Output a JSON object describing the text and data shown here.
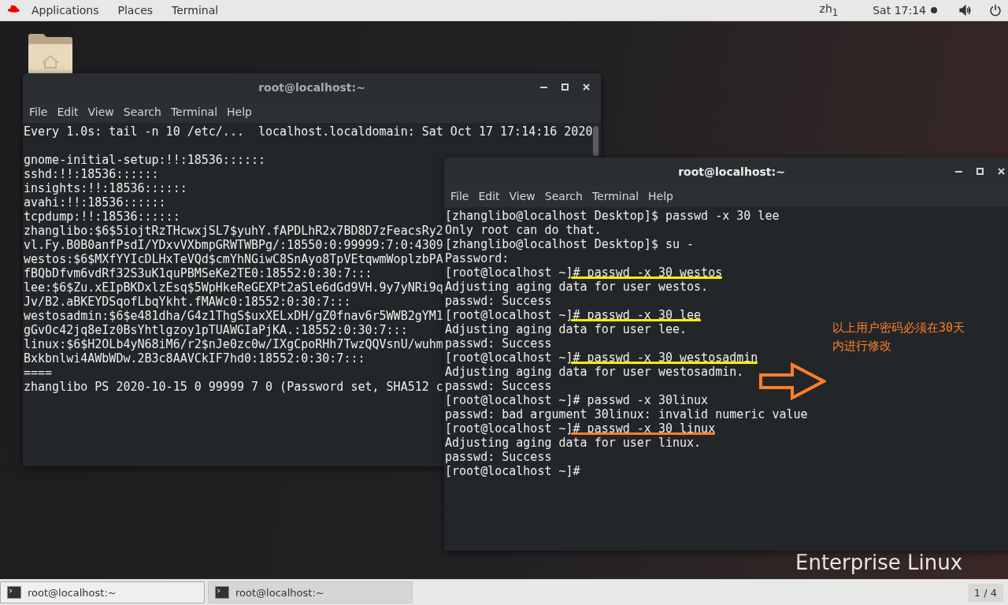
{
  "top_bar": {
    "menus": [
      "Applications",
      "Places",
      "Terminal"
    ],
    "input_method": "zh$_{1}$",
    "clock": "Sat 17:14"
  },
  "desktop": {
    "background_text": "Enterprise Linux"
  },
  "windows": [
    {
      "title": "root@localhost:~",
      "focused": false,
      "menu": [
        "File",
        "Edit",
        "View",
        "Search",
        "Terminal",
        "Help"
      ],
      "header": "Every 1.0s: tail -n 10 /etc/...  localhost.localdomain: Sat Oct 17 17:14:16 2020",
      "lines": [
        {
          "text": "gnome-initial-setup:!!:18536::::::"
        },
        {
          "text": "sshd:!!:18536::::::"
        },
        {
          "text": "insights:!!:18536::::::"
        },
        {
          "text": "avahi:!!:18536::::::"
        },
        {
          "text": "tcpdump:!!:18536::::::"
        },
        {
          "text": "zhanglibo:$6$5iojtRzTHcwxjSL7$yuhY.fAPDLhR2x7BD8D7zFeacsRy2"
        },
        {
          "text": "vl.Fy.B0B0anfPsdI/YDxvVXbmpGRWTWBPg/:18550:0:99999:7:0:4309"
        },
        {
          "text": "westos:$6$MXfYYIcDLHxTeVQd$cmYhNGiwC8SnAyo8TpVEtqwmWoplzbPA"
        },
        {
          "text": "fBQbDfvm6vdRf32S3uK1quPBMSeKe2TE0:18552:0:30:7:::"
        },
        {
          "text": "lee:$6$Zu.xEIpBKDxlzEsq$5WpHkeReGEXPt2aSle6dGd9VH.9y7yNRi9q"
        },
        {
          "text": "Jv/B2.aBKEYDSqofLbqYkht.fMAWc0:18552:0:30:7:::"
        },
        {
          "text": "westosadmin:$6$e481dha/G4z1ThgS$uxXELxDH/gZ0fnav6r5WWB2gYM1"
        },
        {
          "text": "gGvOc42jq8eIz0BsYhtlgzoy1pTUAWGIaPjKA.:18552:0:30:7:::"
        },
        {
          "text": "linux:$6$H2OLb4yN68iM6/r2$nJe0zc0w/IXgCpoRHh7TwzQQVsnU/wuhm"
        },
        {
          "text": "Bxkbnlwi4AWbWDw.2B3c8AAVCkIF7hd0:18552:0:30:7:::"
        },
        {
          "text": "===="
        },
        {
          "text": "zhanglibo PS 2020-10-15 0 99999 7 0 (Password set, SHA512 c"
        }
      ]
    },
    {
      "title": "root@localhost:~",
      "focused": true,
      "menu": [
        "File",
        "Edit",
        "View",
        "Search",
        "Terminal",
        "Help"
      ],
      "lines": [
        {
          "text": "[zhanglibo@localhost Desktop]$ passwd -x 30 lee"
        },
        {
          "text": "Only root can do that."
        },
        {
          "text": "[zhanglibo@localhost Desktop]$ su -"
        },
        {
          "text": "Password:"
        },
        {
          "text": "[root@localhost ~]# passwd -x 30 westos",
          "color": "#ffee00"
        },
        {
          "text": "Adjusting aging data for user westos."
        },
        {
          "text": "passwd: Success"
        },
        {
          "text": "[root@localhost ~]# passwd -x 30 lee",
          "color": "#ffee00"
        },
        {
          "text": "Adjusting aging data for user lee."
        },
        {
          "text": "passwd: Success"
        },
        {
          "text": "[root@localhost ~]# passwd -x 30 westosadmin",
          "color": "#ffee00"
        },
        {
          "text": "Adjusting aging data for user westosadmin."
        },
        {
          "text": "passwd: Success"
        },
        {
          "text": "[root@localhost ~]# passwd -x 30linux"
        },
        {
          "text": "passwd: bad argument 30linux: invalid numeric value"
        },
        {
          "text": "[root@localhost ~]# passwd -x 30 linux",
          "color": "#ff7f27"
        },
        {
          "text": "Adjusting aging data for user linux."
        },
        {
          "text": "passwd: Success"
        },
        {
          "text": "[root@localhost ~]#"
        }
      ],
      "annotation": {
        "note": "以上用户密码必须在30天内进行修改"
      }
    }
  ],
  "taskbar": {
    "items": [
      {
        "label": "root@localhost:~",
        "selected": false
      },
      {
        "label": "root@localhost:~",
        "selected": true
      }
    ],
    "pager": "1 / 4"
  }
}
